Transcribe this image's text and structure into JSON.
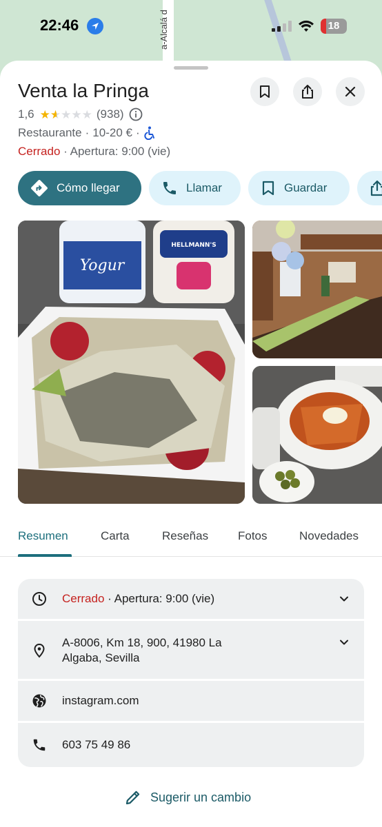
{
  "status_bar": {
    "time": "22:46",
    "battery": "18"
  },
  "map": {
    "road_name": "a-Alcalá d"
  },
  "place": {
    "name": "Venta la Pringa",
    "rating": "1,6",
    "rating_value": 1.6,
    "reviews_count": "(938)",
    "category": "Restaurante",
    "price": "10-20 €",
    "sep": "·",
    "status": "Cerrado",
    "opening": "· Apertura: 9:00 (vie)"
  },
  "actions": {
    "directions": "Cómo llegar",
    "call": "Llamar",
    "save": "Guardar"
  },
  "tabs": [
    "Resumen",
    "Carta",
    "Reseñas",
    "Fotos",
    "Novedades"
  ],
  "info": {
    "hours_status": "Cerrado",
    "hours_opening": "· Apertura: 9:00 (vie)",
    "address_line1": "A-8006, Km 18, 900, 41980 La",
    "address_line2": "Algaba, Sevilla",
    "website": "instagram.com",
    "phone": "603 75 49 86"
  },
  "suggest_edit": "Sugerir un cambio",
  "photos": {
    "main_bottle_label": "Yogur",
    "main_bottle2_label": "HELLMANN'S"
  },
  "colors": {
    "accent": "#2e7281",
    "chip_bg": "#dff3fb",
    "closed_red": "#c5221f",
    "star": "#f4b400"
  }
}
